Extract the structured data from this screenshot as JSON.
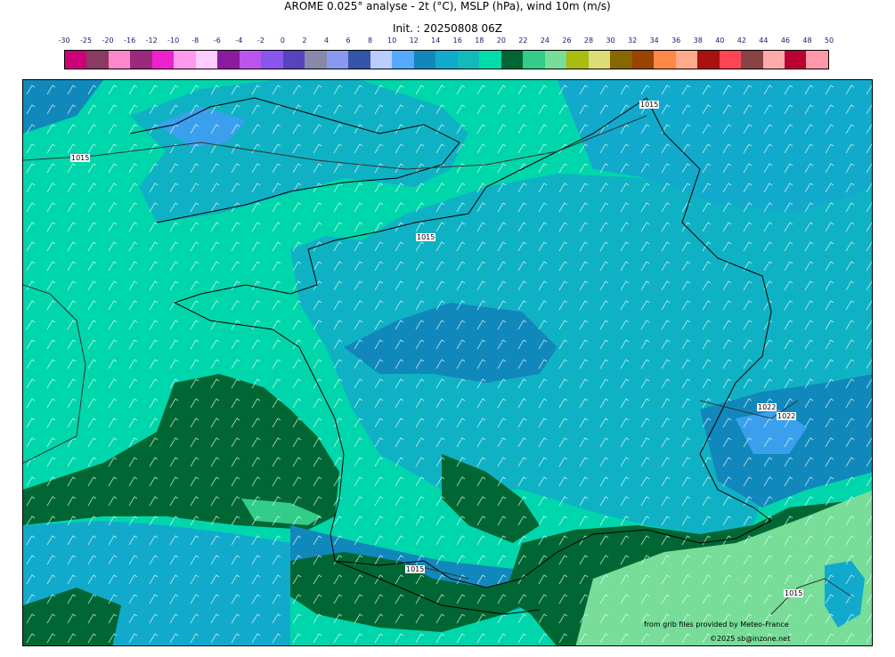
{
  "header": {
    "title": "AROME 0.025° analyse - 2t (°C), MSLP (hPa), wind 10m (m/s)",
    "init": "Init. : 20250808 06Z"
  },
  "color_scale": {
    "labels": [
      "-30",
      "-25",
      "-20",
      "-16",
      "-12",
      "-10",
      "-8",
      "-6",
      "-4",
      "-2",
      "0",
      "2",
      "4",
      "6",
      "8",
      "10",
      "12",
      "14",
      "16",
      "18",
      "20",
      "22",
      "24",
      "26",
      "28",
      "30",
      "32",
      "34",
      "36",
      "38",
      "40",
      "42",
      "44",
      "46",
      "48",
      "50"
    ],
    "colors": [
      "#cc0077",
      "#8a3b62",
      "#ff88cc",
      "#9b2a7e",
      "#ee22cc",
      "#ff99ee",
      "#ffccff",
      "#8b1a9e",
      "#bb55ee",
      "#8855ee",
      "#5544bb",
      "#8888aa",
      "#8899ee",
      "#3355aa",
      "#bbccff",
      "#55aaff",
      "#1188bb",
      "#11aacc",
      "#11bbbb",
      "#00ddaa",
      "#006633",
      "#33cc88",
      "#77dd99",
      "#aabb11",
      "#dddd77",
      "#886600",
      "#994400",
      "#ff8844",
      "#ffaa88",
      "#aa1111",
      "#ff4455",
      "#884444",
      "#ffaaaa",
      "#bb0033",
      "#ff99aa"
    ]
  },
  "map": {
    "isobar_labels": [
      "1015",
      "1015",
      "1015",
      "1015",
      "1022",
      "1022",
      "1015"
    ],
    "fields": {
      "base_color": "#00d6ab",
      "cool_color": "#0fb2c4",
      "cooler_color": "#1188bb",
      "cold_color": "#3aa0ee",
      "warm_color": "#006633",
      "warmer_color": "#33cc88",
      "hot_color": "#77dd99"
    }
  },
  "credits": {
    "source": "from grib files provided by Meteo-France",
    "copyright": "©2025 sb@inzone.net"
  }
}
